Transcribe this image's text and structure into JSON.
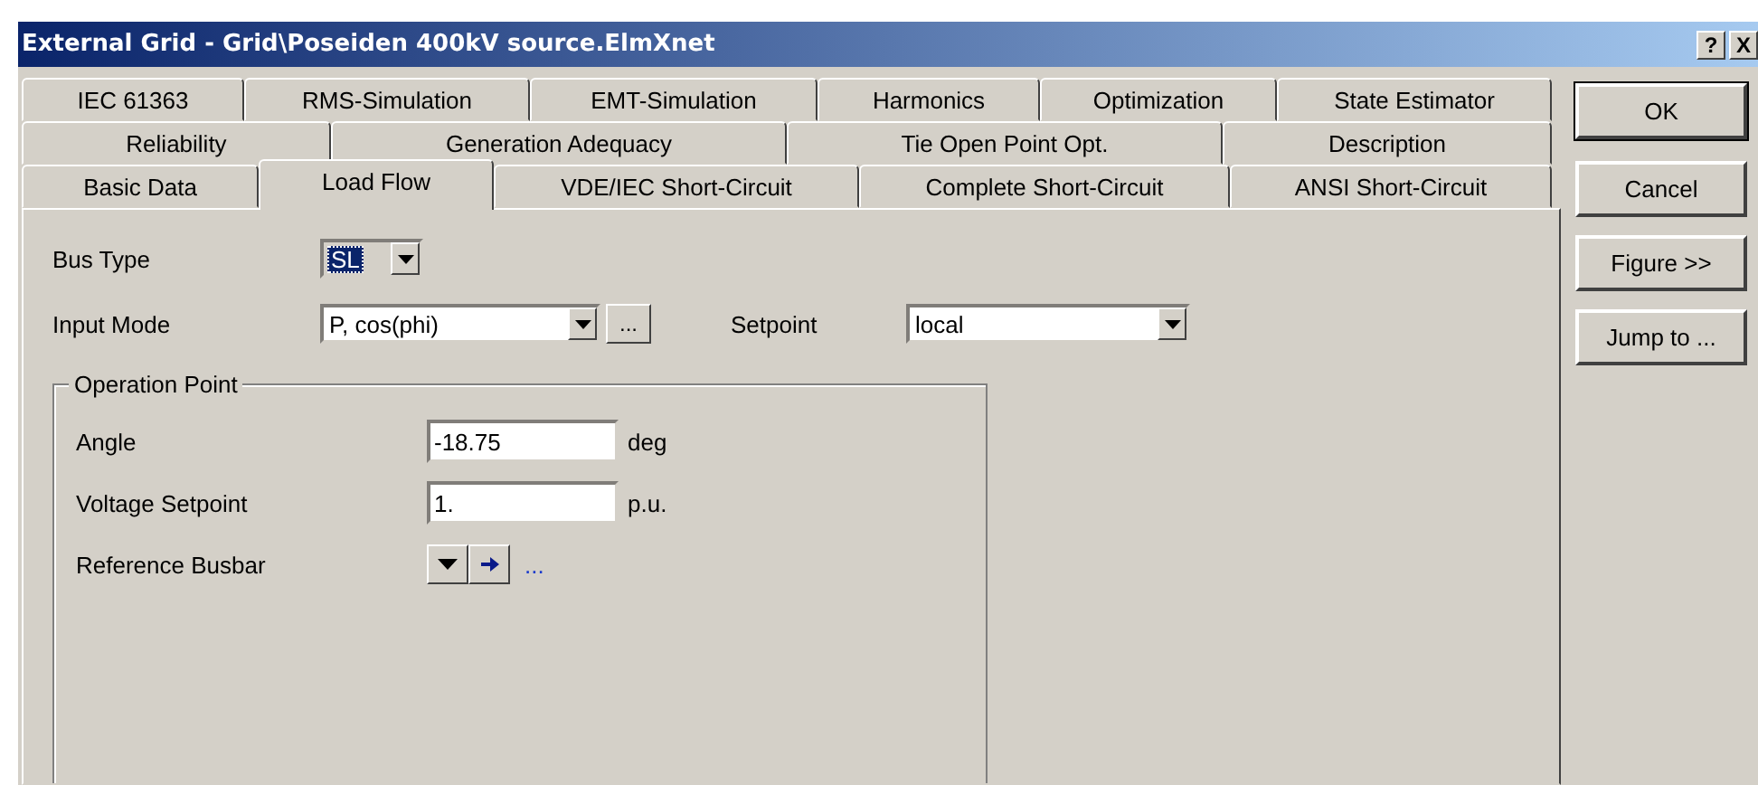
{
  "window": {
    "title": "External Grid - Grid\\Poseiden 400kV source.ElmXnet",
    "help_button": "?",
    "close_button": "X"
  },
  "tab_rows": [
    [
      {
        "label": "IEC 61363",
        "selected": false
      },
      {
        "label": "RMS-Simulation",
        "selected": false
      },
      {
        "label": "EMT-Simulation",
        "selected": false
      },
      {
        "label": "Harmonics",
        "selected": false
      },
      {
        "label": "Optimization",
        "selected": false
      },
      {
        "label": "State Estimator",
        "selected": false
      }
    ],
    [
      {
        "label": "Reliability",
        "selected": false
      },
      {
        "label": "Generation Adequacy",
        "selected": false
      },
      {
        "label": "Tie Open Point Opt.",
        "selected": false
      },
      {
        "label": "Description",
        "selected": false
      }
    ],
    [
      {
        "label": "Basic Data",
        "selected": false
      },
      {
        "label": "Load Flow",
        "selected": true
      },
      {
        "label": "VDE/IEC Short-Circuit",
        "selected": false
      },
      {
        "label": "Complete Short-Circuit",
        "selected": false
      },
      {
        "label": "ANSI Short-Circuit",
        "selected": false
      }
    ]
  ],
  "bus_type": {
    "label": "Bus Type",
    "value": "SL",
    "focused": true
  },
  "input_mode": {
    "label": "Input Mode",
    "value": "P, cos(phi)",
    "more_button": "..."
  },
  "setpoint": {
    "label": "Setpoint",
    "value": "local"
  },
  "operation_point": {
    "title": "Operation Point",
    "rows": [
      {
        "label": "Angle",
        "value": "-18.75",
        "unit": "deg"
      },
      {
        "label": "Voltage Setpoint",
        "value": "1.",
        "unit": "p.u."
      }
    ],
    "reference_busbar": {
      "label": "Reference Busbar",
      "link": "..."
    }
  },
  "buttons": [
    {
      "label": "OK",
      "default": true
    },
    {
      "label": "Cancel",
      "default": false
    },
    {
      "label": "Figure >>",
      "default": false
    },
    {
      "label": "Jump to ...",
      "default": false
    }
  ]
}
